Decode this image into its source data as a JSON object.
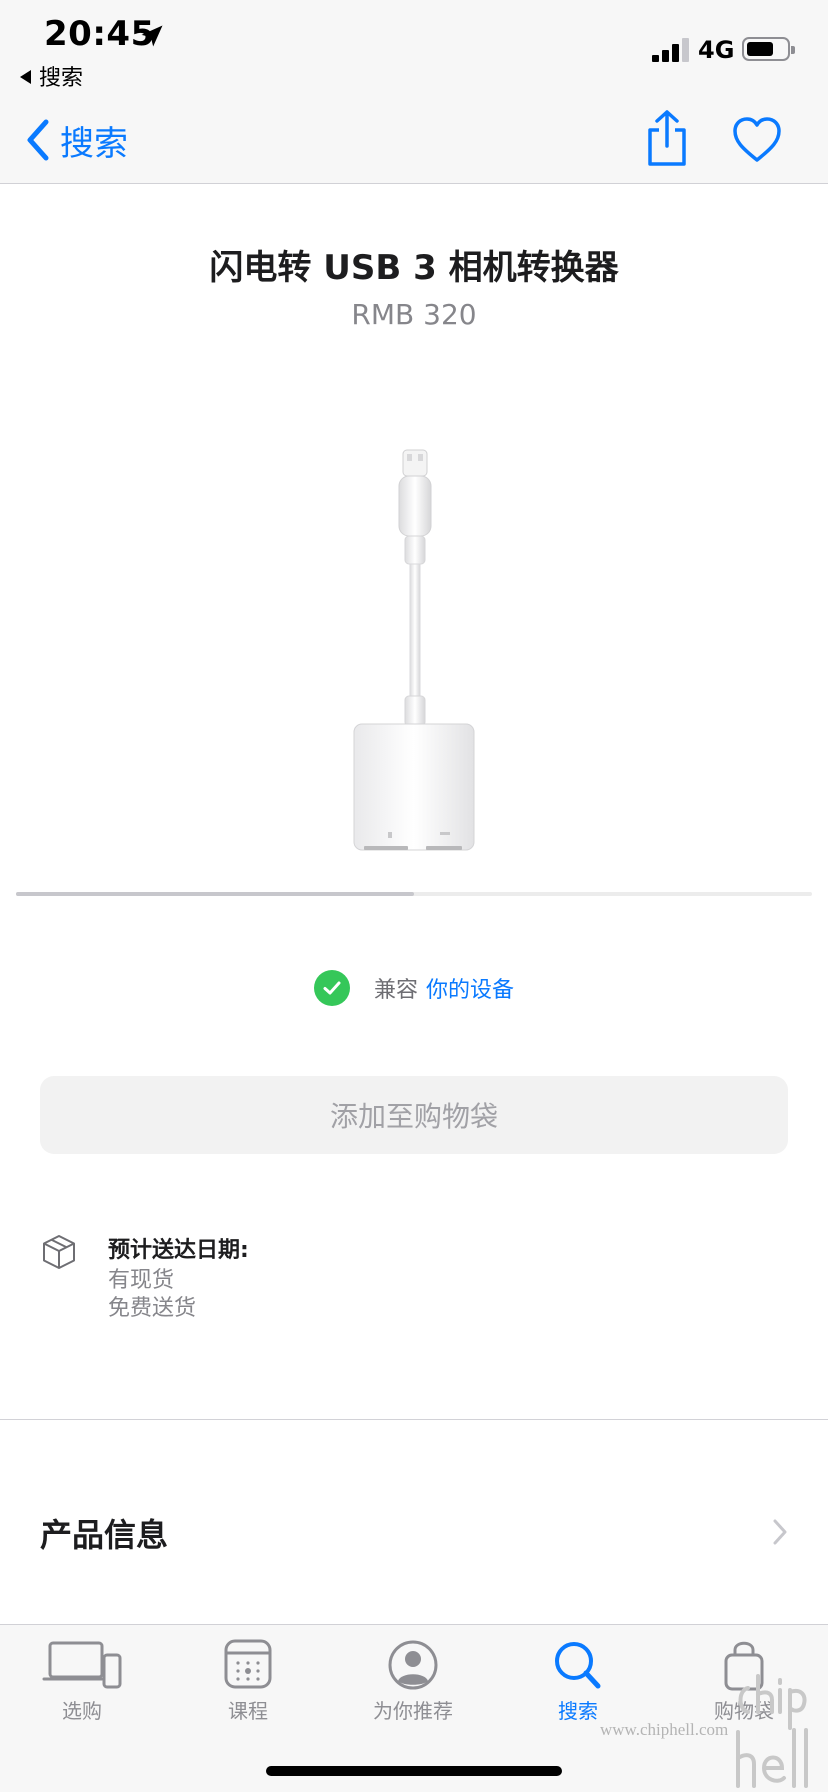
{
  "status_bar": {
    "time": "20:45",
    "back_app_label": "搜索",
    "network": "4G",
    "icons": [
      "location-arrow-icon",
      "signal-bars-icon",
      "battery-icon"
    ]
  },
  "nav": {
    "back_label": "搜索",
    "icons": [
      "chevron-left-icon",
      "share-icon",
      "heart-icon"
    ]
  },
  "product": {
    "title": "闪电转 USB 3 相机转换器",
    "price": "RMB 320"
  },
  "carousel": {
    "progress_fraction": 0.5
  },
  "compatibility": {
    "label": "兼容",
    "link": "你的设备",
    "status_color": "#35c759"
  },
  "add_to_bag": {
    "label": "添加至购物袋"
  },
  "delivery": {
    "title": "预计送达日期:",
    "availability": "有现货",
    "shipping": "免费送货"
  },
  "product_info": {
    "title": "产品信息"
  },
  "tab_bar": {
    "tabs": [
      {
        "label": "选购",
        "icon": "devices-icon",
        "active": false
      },
      {
        "label": "课程",
        "icon": "calendar-icon",
        "active": false
      },
      {
        "label": "为你推荐",
        "icon": "person-icon",
        "active": false
      },
      {
        "label": "搜索",
        "icon": "search-icon",
        "active": true
      },
      {
        "label": "购物袋",
        "icon": "bag-icon",
        "active": false
      }
    ]
  },
  "watermark": {
    "text": "www.chiphell.com"
  },
  "colors": {
    "accent": "#0a7aff",
    "bar_background": "#f7f7f7",
    "disabled_button": "#f2f2f2",
    "secondary_text": "#86868b"
  }
}
